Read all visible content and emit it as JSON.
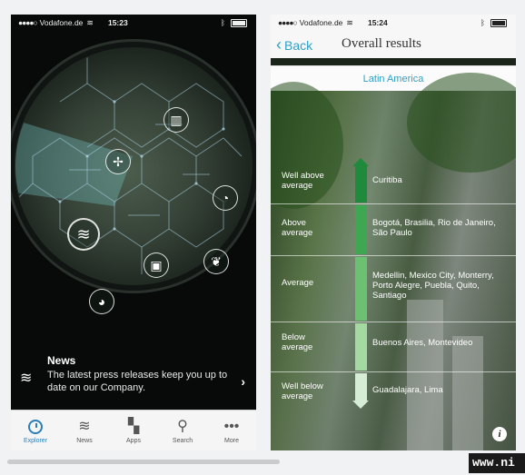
{
  "left_phone": {
    "status": {
      "carrier": "Vodafone.de",
      "time": "15:23"
    },
    "news": {
      "title": "News",
      "text": "The latest press releases keep you up to date on our Company."
    },
    "tabs": [
      {
        "label": "Explorer",
        "icon": "explorer-icon",
        "active": true
      },
      {
        "label": "News",
        "icon": "wifi-icon",
        "active": false
      },
      {
        "label": "Apps",
        "icon": "apps-icon",
        "active": false
      },
      {
        "label": "Search",
        "icon": "search-icon",
        "active": false
      },
      {
        "label": "More",
        "icon": "more-icon",
        "active": false
      }
    ]
  },
  "right_phone": {
    "status": {
      "carrier": "Vodafone.de",
      "time": "15:24"
    },
    "back_label": "Back",
    "title": "Overall results",
    "region": "Latin America",
    "rows": [
      {
        "category": "Well above average",
        "cities": "Curitiba",
        "color": "#1f8a3b"
      },
      {
        "category": "Above average",
        "cities": "Bogotá, Brasilia, Rio de Janeiro, São Paulo",
        "color": "#3fa652"
      },
      {
        "category": "Average",
        "cities": "Medellin, Mexico City, Monterry, Porto Alegre, Puebla, Quito, Santiago",
        "color": "#6cc071"
      },
      {
        "category": "Below average",
        "cities": "Buenos Aires, Montevideo",
        "color": "#a5d9a2"
      },
      {
        "category": "Well below average",
        "cities": "Guadalajara, Lima",
        "color": "#d6ecd4"
      }
    ]
  },
  "watermark": "www.ni"
}
